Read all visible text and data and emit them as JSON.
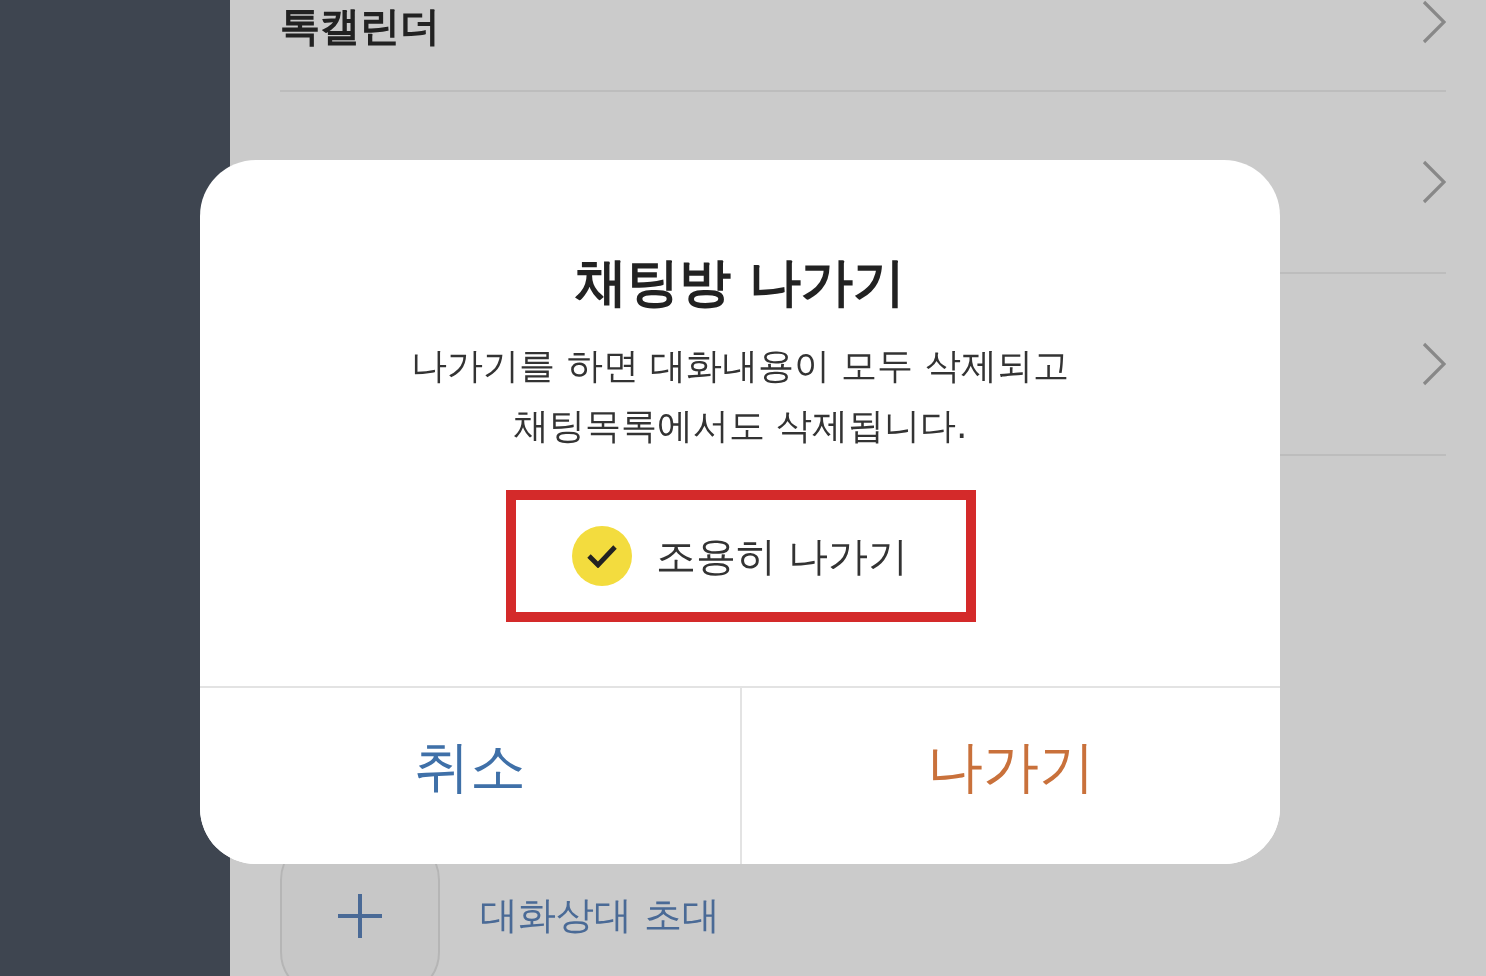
{
  "menu_rows": [
    {
      "label": "톡캘린더"
    }
  ],
  "dialog": {
    "title": "채팅방 나가기",
    "message_lines": [
      "나가기를 하면 대화내용이 모두 삭제되고",
      "채팅목록에서도 삭제됩니다."
    ],
    "option": {
      "label": "조용히 나가기",
      "checked": true
    },
    "buttons": [
      {
        "label": "취소",
        "kind": "cancel"
      },
      {
        "label": "나가기",
        "kind": "confirm"
      }
    ]
  },
  "invite": {
    "label": "대화상대 초대"
  }
}
